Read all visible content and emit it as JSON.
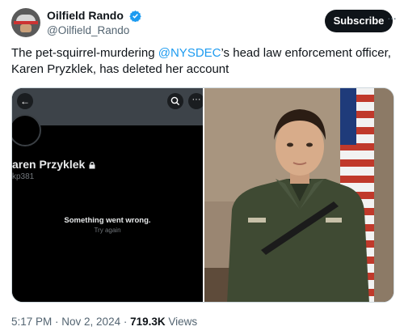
{
  "account": {
    "display_name": "Oilfield Rando",
    "handle": "@Oilfield_Rando"
  },
  "header": {
    "subscribe_label": "Subscribe",
    "more_label": "···"
  },
  "tweet": {
    "text_before": "The pet-squirrel-murdering ",
    "mention": "@NYSDEC",
    "text_after": "’s head law enforcement officer, Karen Pryzklek, has deleted her account"
  },
  "media": {
    "left": {
      "profile_name": "aren Przyklek",
      "profile_handle": "kp381",
      "error_title": "Something went wrong.",
      "error_subtitle": "Try again",
      "back_icon": "←",
      "more_icon": "···"
    }
  },
  "meta": {
    "time": "5:17 PM",
    "sep1": " · ",
    "date": "Nov 2, 2024",
    "sep2": " · ",
    "views_count": "719.3K",
    "views_label": " Views"
  },
  "colors": {
    "accent": "#1d9bf0",
    "text": "#0f1419",
    "muted": "#536471"
  }
}
